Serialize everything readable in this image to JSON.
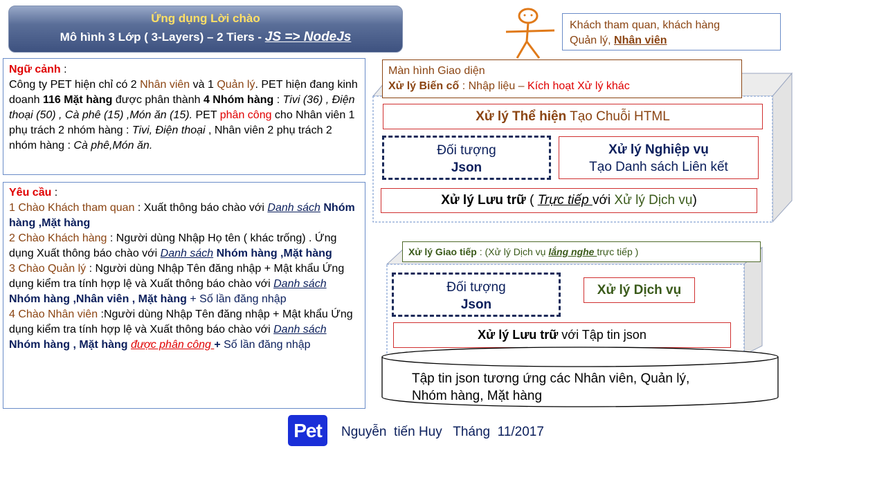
{
  "banner": {
    "title": "Ứng dụng Lời chào",
    "subtitle": "Mô hình 3 Lớp ( 3-Layers) – 2 Tiers - ",
    "tech": "JS => NodeJs"
  },
  "context": {
    "label": "Ngữ cảnh",
    "l1a": "  Công ty PET hiện chỉ có 2 ",
    "l1_staff": "Nhân viên",
    "l1b": " và 1 ",
    "l1_mgr": "Quản lý",
    "l1c": ".  PET hiện đang kinh doanh ",
    "items": "116 Mặt hàng",
    "l1d": " được phân thành ",
    "groups": "4 Nhóm hàng",
    "l1e": "  : ",
    "group_list": "Tivi (36) , Điện thoại (50) , Cà phê (15) ,Món ăn (15).",
    "l1f": " PET ",
    "assign": "phân công",
    "l1g": " cho Nhân viên 1 phụ trách  2 nhóm hàng : ",
    "g1": "Tivi, Điện thoại",
    "l1h": " , Nhân viên 2 phụ trách 2 nhóm hàng : ",
    "g2": "Cà phê,Món ăn."
  },
  "requirements": {
    "label": "Yêu cầu",
    "r1_head": "1 Chào Khách tham quan",
    "r1_text": " :  Xuất thông báo chào với ",
    "r1_link": "Danh sách",
    "r1_bold": "Nhóm hàng ,Mặt hàng",
    "r2_head": "2 Chào Khách hàng",
    "r2_text": " :  Người dùng Nhập  Họ tên ( khác trống) . Ứng dụng Xuất thông báo chào với ",
    "r2_link": "Danh sách",
    "r2_bold": "Nhóm hàng ,Mặt hàng",
    "r3_head": "3 Chào Quản lý",
    "r3_text": " : Người dùng Nhập  Tên đăng nhập + Mật khẩu Ứng dụng kiểm tra tính hợp lệ và Xuất thông báo chào với ",
    "r3_link": "Danh sách",
    "r3_bold": "Nhóm hàng ,Nhân viên , Mặt hàng",
    "r3_tail": " + Số lần đăng nhập",
    "r4_head": "4 Chào Nhân viên",
    "r4_text": " :Người dùng Nhập  Tên đăng nhập + Mật khẩu Ứng dụng kiểm tra tính hợp lệ và Xuất thông báo chào với ",
    "r4_link": "Danh sách",
    "r4_bold": "Nhóm hàng , Mặt hàng",
    "r4_red": "được phân công ",
    "r4_plus": "+",
    "r4_tail": " Số lần đăng nhập"
  },
  "client": {
    "line1": "Khách tham quan, khách hàng",
    "line2a": "Quản lý, ",
    "line2b": "Nhân viên"
  },
  "ui_layer": {
    "line1": "Màn hình  Giao diện",
    "event_bold": "Xử lý Biến cố",
    "event_text": " : Nhập liệu – ",
    "event_red": "Kích hoạt Xử lý khác"
  },
  "client_tier": {
    "render_bold": "Xử lý Thể hiện",
    "render_text": " Tạo Chuỗi HTML",
    "obj_line1": "Đối tượng",
    "obj_line2": "Json",
    "biz_bold": "Xử lý Nghiệp vụ",
    "biz_text": "Tạo Danh sách Liên kết",
    "store_bold": "Xử lý Lưu trữ",
    "store_a": "  ( ",
    "store_direct": "Trực tiếp ",
    "store_b": "với ",
    "store_green": "Xử lý  Dịch vụ",
    "store_c": ")"
  },
  "server_tier": {
    "comm_bold": "Xử lý Giao tiếp",
    "comm_a": " :   (Xử lý Dịch vụ  ",
    "comm_listen": "lắng nghe ",
    "comm_b": "trực tiếp  )",
    "obj_line1": "Đối tượng",
    "obj_line2": "Json",
    "service": "Xử lý Dịch vụ",
    "store_bold": "Xử lý Lưu trữ",
    "store_text": "  với Tập tin json"
  },
  "database": {
    "line1": "Tập tin json  tương ứng các Nhân viên, Quản lý,",
    "line2": "Nhóm hàng, Mặt hàng"
  },
  "footer": {
    "logo": "Pet",
    "author": "Nguyễn  tiến Huy   Tháng  11/2017"
  }
}
